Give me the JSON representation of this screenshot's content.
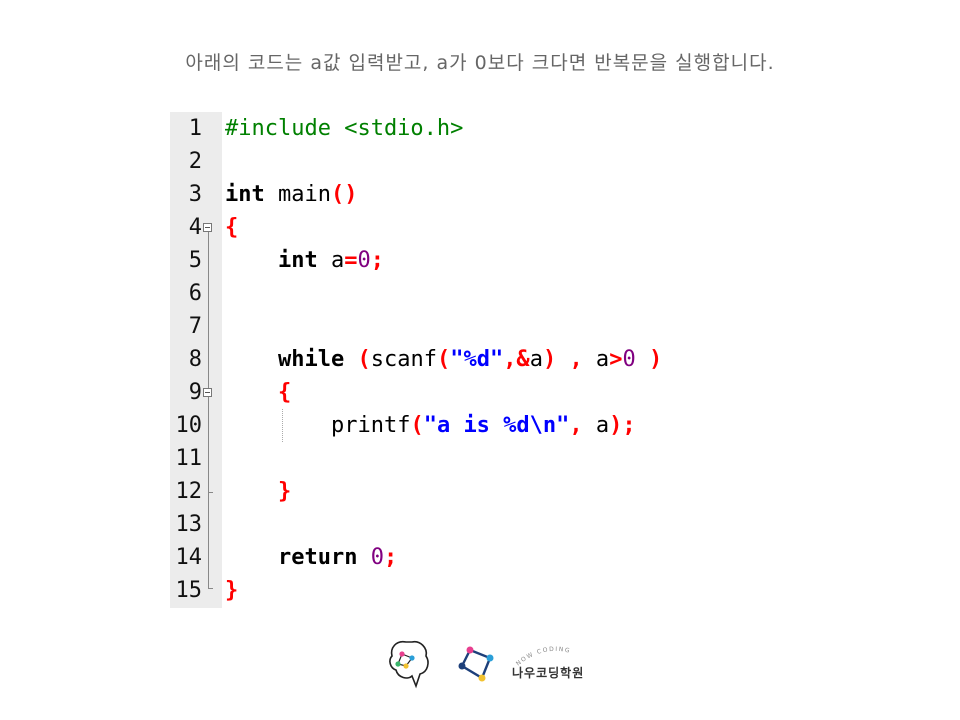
{
  "caption": "아래의 코드는 a값 입력받고, a가 0보다 크다면 반복문을 실행합니다.",
  "code_lines": [
    {
      "num": "1",
      "tokens": [
        {
          "t": "#include <stdio.h>",
          "c": "#008000",
          "b": false
        }
      ]
    },
    {
      "num": "2",
      "tokens": []
    },
    {
      "num": "3",
      "tokens": [
        {
          "t": "int",
          "c": "#000000",
          "b": true
        },
        {
          "t": " main",
          "c": "#000000",
          "b": false
        },
        {
          "t": "()",
          "c": "#ff0000",
          "b": true
        }
      ]
    },
    {
      "num": "4",
      "tokens": [
        {
          "t": "{",
          "c": "#ff0000",
          "b": true
        }
      ]
    },
    {
      "num": "5",
      "tokens": [
        {
          "t": "    ",
          "c": "#000000",
          "b": false
        },
        {
          "t": "int",
          "c": "#000000",
          "b": true
        },
        {
          "t": " a",
          "c": "#000000",
          "b": false
        },
        {
          "t": "=",
          "c": "#ff0000",
          "b": true
        },
        {
          "t": "0",
          "c": "#800080",
          "b": false
        },
        {
          "t": ";",
          "c": "#ff0000",
          "b": true
        }
      ]
    },
    {
      "num": "6",
      "tokens": []
    },
    {
      "num": "7",
      "tokens": []
    },
    {
      "num": "8",
      "tokens": [
        {
          "t": "    ",
          "c": "#000000",
          "b": false
        },
        {
          "t": "while",
          "c": "#000000",
          "b": true
        },
        {
          "t": " ",
          "c": "#000000",
          "b": false
        },
        {
          "t": "(",
          "c": "#ff0000",
          "b": true
        },
        {
          "t": "scanf",
          "c": "#000000",
          "b": false
        },
        {
          "t": "(",
          "c": "#ff0000",
          "b": true
        },
        {
          "t": "\"%d\"",
          "c": "#0000ff",
          "b": true
        },
        {
          "t": ",&",
          "c": "#ff0000",
          "b": true
        },
        {
          "t": "a",
          "c": "#000000",
          "b": false
        },
        {
          "t": ")",
          "c": "#ff0000",
          "b": true
        },
        {
          "t": " ",
          "c": "#000000",
          "b": false
        },
        {
          "t": ",",
          "c": "#ff0000",
          "b": true
        },
        {
          "t": " a",
          "c": "#000000",
          "b": false
        },
        {
          "t": ">",
          "c": "#ff0000",
          "b": true
        },
        {
          "t": "0",
          "c": "#800080",
          "b": false
        },
        {
          "t": " ",
          "c": "#000000",
          "b": false
        },
        {
          "t": ")",
          "c": "#ff0000",
          "b": true
        }
      ]
    },
    {
      "num": "9",
      "tokens": [
        {
          "t": "    ",
          "c": "#000000",
          "b": false
        },
        {
          "t": "{",
          "c": "#ff0000",
          "b": true
        }
      ]
    },
    {
      "num": "10",
      "tokens": [
        {
          "t": "        ",
          "c": "#000000",
          "b": false
        },
        {
          "t": "printf",
          "c": "#000000",
          "b": false
        },
        {
          "t": "(",
          "c": "#ff0000",
          "b": true
        },
        {
          "t": "\"a is %d\\n\"",
          "c": "#0000ff",
          "b": true
        },
        {
          "t": ",",
          "c": "#ff0000",
          "b": true
        },
        {
          "t": " a",
          "c": "#000000",
          "b": false
        },
        {
          "t": ");",
          "c": "#ff0000",
          "b": true
        }
      ]
    },
    {
      "num": "11",
      "tokens": []
    },
    {
      "num": "12",
      "tokens": [
        {
          "t": "    ",
          "c": "#000000",
          "b": false
        },
        {
          "t": "}",
          "c": "#ff0000",
          "b": true
        }
      ]
    },
    {
      "num": "13",
      "tokens": []
    },
    {
      "num": "14",
      "tokens": [
        {
          "t": "    ",
          "c": "#000000",
          "b": false
        },
        {
          "t": "return",
          "c": "#000000",
          "b": true
        },
        {
          "t": " ",
          "c": "#000000",
          "b": false
        },
        {
          "t": "0",
          "c": "#800080",
          "b": false
        },
        {
          "t": ";",
          "c": "#ff0000",
          "b": true
        }
      ]
    },
    {
      "num": "15",
      "tokens": [
        {
          "t": "}",
          "c": "#ff0000",
          "b": true
        }
      ]
    }
  ],
  "logo": {
    "arc_text": "NOW CODING",
    "name": "나우코딩학원",
    "icon": "brain-network-icon",
    "mark_icon": "network-diamond-icon"
  }
}
